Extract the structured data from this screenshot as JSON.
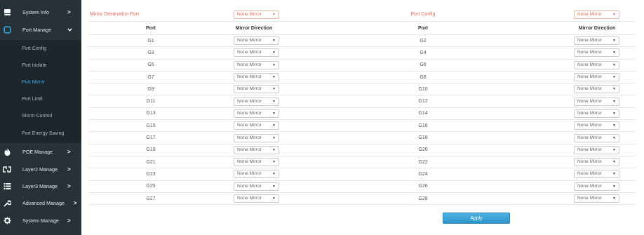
{
  "sidebar": {
    "items": [
      {
        "label": "System Info",
        "icon": "server-icon"
      },
      {
        "label": "Port Manage",
        "icon": "square-icon"
      },
      {
        "label": "POE Manage",
        "icon": "poe-icon"
      },
      {
        "label": "Layer2 Manage",
        "icon": "layer2-icon"
      },
      {
        "label": "Layer3 Manage",
        "icon": "list-icon"
      },
      {
        "label": "Advanced Manage",
        "icon": "wrench-icon"
      },
      {
        "label": "System Manage",
        "icon": "gear-icon"
      }
    ],
    "sub_items": [
      "Port Config",
      "Port Isolate",
      "Port Mirror",
      "Port Limit",
      "Storm Control",
      "Port Energy Saving"
    ],
    "active_sub": "Port Mirror",
    "arrow_right": ">",
    "arrow_down": "⌄"
  },
  "mirror": {
    "dest_label": "Mirror Destination Port",
    "dest_value": "None Mirror",
    "config_label": "Port Config",
    "config_value": "None Mirror",
    "headers": {
      "port": "Port",
      "direction": "Mirror Direction"
    },
    "rows": [
      {
        "left_port": "G1",
        "left_dir": "None Mirror",
        "right_port": "G2",
        "right_dir": "None Mirror"
      },
      {
        "left_port": "G3",
        "left_dir": "None Mirror",
        "right_port": "G4",
        "right_dir": "None Mirror"
      },
      {
        "left_port": "G5",
        "left_dir": "None Mirror",
        "right_port": "G6",
        "right_dir": "None Mirror"
      },
      {
        "left_port": "G7",
        "left_dir": "None Mirror",
        "right_port": "G8",
        "right_dir": "None Mirror"
      },
      {
        "left_port": "G9",
        "left_dir": "None Mirror",
        "right_port": "G10",
        "right_dir": "None Mirror"
      },
      {
        "left_port": "G11",
        "left_dir": "None Mirror",
        "right_port": "G12",
        "right_dir": "None Mirror"
      },
      {
        "left_port": "G13",
        "left_dir": "None Mirror",
        "right_port": "G14",
        "right_dir": "None Mirror"
      },
      {
        "left_port": "G15",
        "left_dir": "None Mirror",
        "right_port": "G16",
        "right_dir": "None Mirror"
      },
      {
        "left_port": "G17",
        "left_dir": "None Mirror",
        "right_port": "G18",
        "right_dir": "None Mirror"
      },
      {
        "left_port": "G19",
        "left_dir": "None Mirror",
        "right_port": "G20",
        "right_dir": "None Mirror"
      },
      {
        "left_port": "G21",
        "left_dir": "None Mirror",
        "right_port": "G22",
        "right_dir": "None Mirror"
      },
      {
        "left_port": "G23",
        "left_dir": "None Mirror",
        "right_port": "G24",
        "right_dir": "None Mirror"
      },
      {
        "left_port": "G25",
        "left_dir": "None Mirror",
        "right_port": "G26",
        "right_dir": "None Mirror"
      },
      {
        "left_port": "G27",
        "left_dir": "None Mirror",
        "right_port": "G28",
        "right_dir": "None Mirror"
      }
    ],
    "apply_label": "Apply"
  },
  "colors": {
    "sidebar_bg": "#263238",
    "submenu_bg": "#1d262b",
    "accent_active": "#35a7e6",
    "highlight_red": "#e06a55",
    "apply_blue": "#3ea3d8"
  }
}
